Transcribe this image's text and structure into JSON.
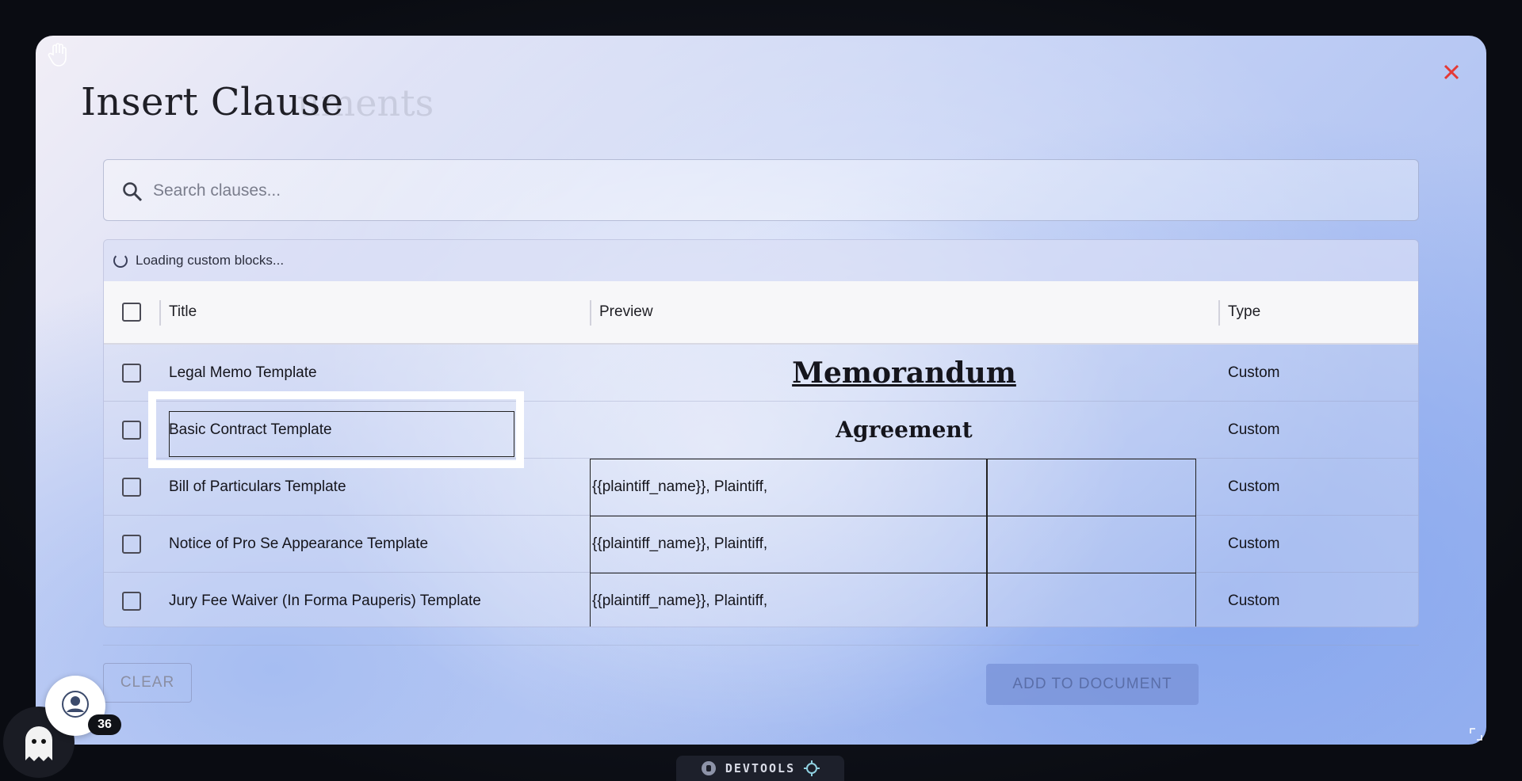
{
  "modal": {
    "title": "Insert Clause",
    "ghost_title": "uments",
    "close_icon": "close-icon",
    "close_color": "#e53935"
  },
  "search": {
    "placeholder": "Search clauses...",
    "value": ""
  },
  "loading": {
    "text": "Loading custom blocks..."
  },
  "table": {
    "columns": {
      "title": "Title",
      "preview": "Preview",
      "type": "Type"
    },
    "rows": [
      {
        "title": "Legal Memo Template",
        "preview": "Memorandum",
        "type": "Custom"
      },
      {
        "title": "Basic Contract Template",
        "preview": "Agreement",
        "type": "Custom"
      },
      {
        "title": "Bill of Particulars Template",
        "preview": "{{plaintiff_name}}, Plaintiff,",
        "type": "Custom"
      },
      {
        "title": "Notice of Pro Se Appearance Template",
        "preview": "{{plaintiff_name}}, Plaintiff,",
        "type": "Custom"
      },
      {
        "title": "Jury Fee Waiver (In Forma Pauperis) Template",
        "preview": "{{plaintiff_name}}, Plaintiff,",
        "type": "Custom"
      }
    ]
  },
  "actions": {
    "clear_label": "CLEAR",
    "add_label": "ADD TO DOCUMENT"
  },
  "badge": {
    "count": "36"
  },
  "devtools": {
    "label": "DEVTOOLS"
  },
  "colors": {
    "accent": "#8ea7ea",
    "text": "#15151c"
  }
}
